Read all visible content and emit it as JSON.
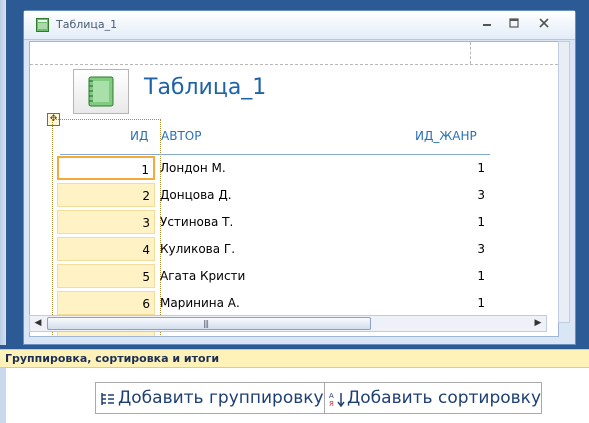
{
  "window": {
    "title": "Таблица_1"
  },
  "report": {
    "title": "Таблица_1"
  },
  "columns": {
    "id": "ИД",
    "author": "АВТОР",
    "genre": "ИД_ЖАНР"
  },
  "rows": [
    {
      "id": "1",
      "author": "Лондон М.",
      "genre": "1"
    },
    {
      "id": "2",
      "author": "Донцова Д.",
      "genre": "3"
    },
    {
      "id": "3",
      "author": "Устинова Т.",
      "genre": "1"
    },
    {
      "id": "4",
      "author": "Куликова Г.",
      "genre": "3"
    },
    {
      "id": "5",
      "author": "Агата Кристи",
      "genre": "1"
    },
    {
      "id": "6",
      "author": "Маринина А.",
      "genre": "1"
    }
  ],
  "panel": {
    "title": "Группировка, сортировка и итоги",
    "add_group": "Добавить группировку",
    "add_sort": "Добавить сортировку"
  }
}
